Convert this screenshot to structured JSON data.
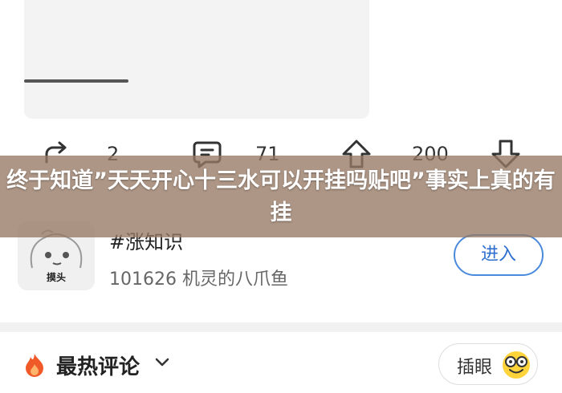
{
  "actions": {
    "share_count": "2",
    "comment_count": "71",
    "upvote_count": "200"
  },
  "topic": {
    "avatar_label": "摸头",
    "title": "#涨知识",
    "meta": "101626 机灵的八爪鱼",
    "enter_label": "进入"
  },
  "comments": {
    "title": "最热评论",
    "chayan_label": "插眼"
  },
  "overlay": {
    "headline": "终于知道”天天开心十三水可以开挂吗贴吧”事实上真的有挂"
  },
  "colors": {
    "accent": "#4a89dc",
    "overlay": "#96786 4",
    "hot": "#f05a28"
  }
}
